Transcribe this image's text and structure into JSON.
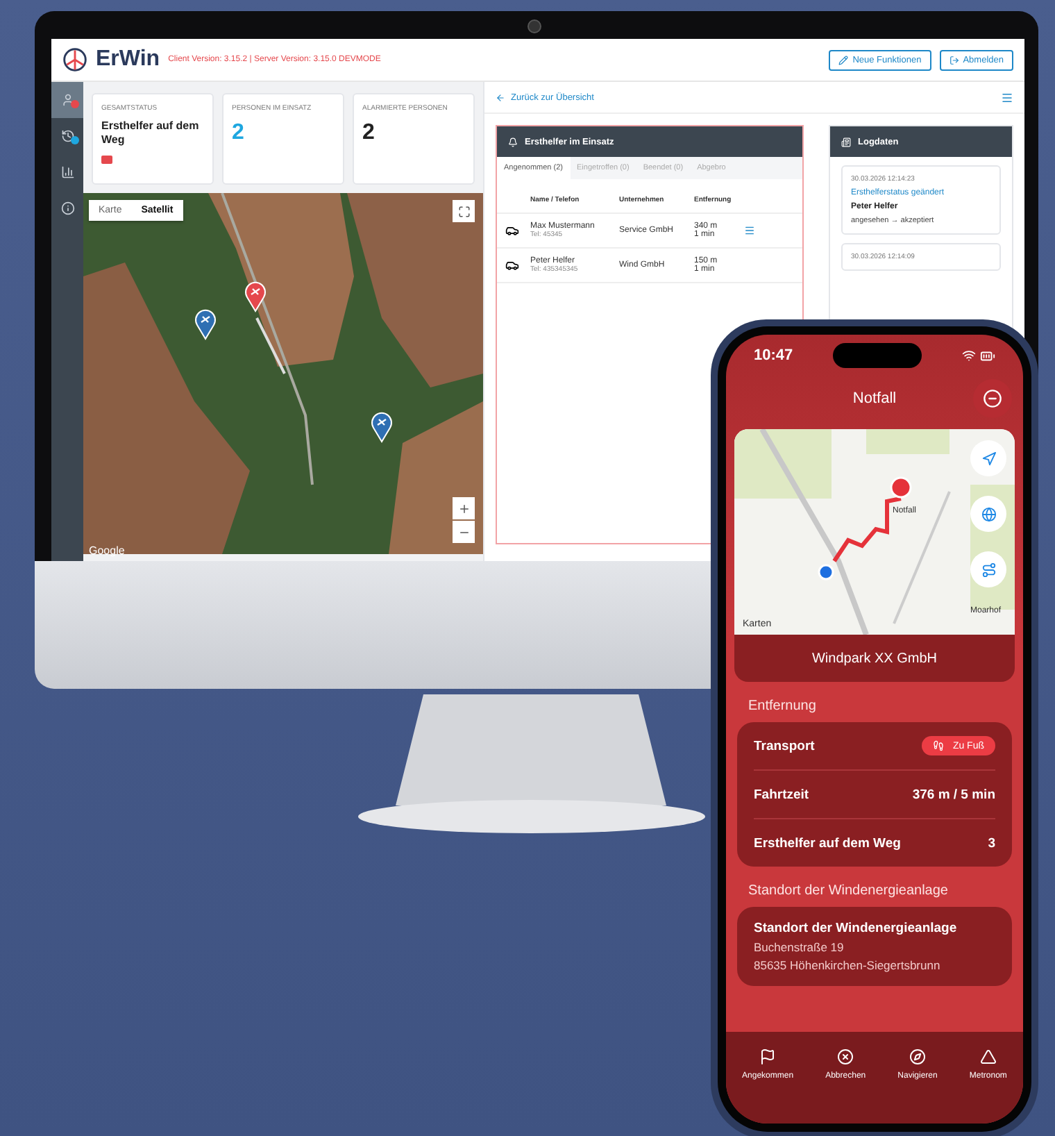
{
  "desktop": {
    "header": {
      "logo": "ErWin",
      "version": "Client Version: 3.15.2 | Server Version: 3.15.0  DEVMODE",
      "buttons": [
        {
          "kind": "new",
          "label": "Neue Funktionen"
        },
        {
          "kind": "logout",
          "label": "Abmelden"
        }
      ]
    },
    "sidebar": [
      {
        "kind": "alarm",
        "selected": true,
        "color": "#e5484d"
      },
      {
        "kind": "history",
        "selected": false,
        "color": "#1ea7e0"
      },
      {
        "kind": "chart",
        "selected": false
      },
      {
        "kind": "info",
        "selected": false
      }
    ],
    "stats": [
      {
        "kind": "status",
        "label": "GESAMTSTATUS",
        "value": "Ersthelfer auf dem Weg"
      },
      {
        "kind": "highlight",
        "label": "PERSONEN IM EINSATZ",
        "value": "2"
      },
      {
        "kind": "plain",
        "label": "ALARMIERTE PERSONEN",
        "value": "2"
      }
    ],
    "map": {
      "modes": [
        {
          "label": "Karte",
          "selected": false
        },
        {
          "label": "Satellit",
          "selected": true
        }
      ],
      "brand": "Google"
    },
    "back_link": "Zurück zur Übersicht",
    "helpers": {
      "title": "Ersthelfer im Einsatz",
      "tabs": [
        {
          "label": "Angenommen (2)",
          "selected": true
        },
        {
          "label": "Eingetroffen (0)",
          "selected": false
        },
        {
          "label": "Beendet (0)",
          "selected": false
        },
        {
          "label": "Abgebro",
          "selected": false
        }
      ],
      "columns": [
        "Name / Telefon",
        "Unternehmen",
        "Entfernung"
      ],
      "rows": [
        {
          "name": "Max Mustermann",
          "phone": "Tel: 45345",
          "company": "Service GmbH",
          "distance": "340 m",
          "time": "1 min"
        },
        {
          "name": "Peter Helfer",
          "phone": "Tel: 435345345",
          "company": "Wind GmbH",
          "distance": "150 m",
          "time": "1 min"
        }
      ]
    },
    "logs": {
      "title": "Logdaten",
      "entries": [
        {
          "time": "30.03.2026 12:14:23",
          "event": "Ersthelferstatus geändert",
          "person": "Peter Helfer",
          "change": "angesehen → akzeptiert"
        },
        {
          "time": "30.03.2026 12:14:09"
        }
      ]
    }
  },
  "phone": {
    "time": "10:47",
    "title": "Notfall",
    "map": {
      "pin_label": "Notfall",
      "place": "Moarhof",
      "brand": "Karten"
    },
    "company": "Windpark XX GmbH",
    "distance": {
      "heading": "Entfernung",
      "rows": [
        {
          "kind": "badge",
          "label": "Transport",
          "value": "Zu Fuß"
        },
        {
          "kind": "text",
          "label": "Fahrtzeit",
          "value": "376 m / 5 min"
        },
        {
          "kind": "text",
          "label": "Ersthelfer auf dem Weg",
          "value": "3"
        }
      ]
    },
    "location": {
      "heading": "Standort der Windenergieanlage",
      "title": "Standort der Windenergieanlage",
      "lines": [
        "Buchenstraße 19",
        "85635 Höhenkirchen-Siegertsbrunn"
      ]
    },
    "tabs": [
      {
        "kind": "flag",
        "label": "Angekommen"
      },
      {
        "kind": "cancel",
        "label": "Abbrechen"
      },
      {
        "kind": "compass",
        "label": "Navigieren"
      },
      {
        "kind": "metronome",
        "label": "Metronom"
      }
    ]
  }
}
